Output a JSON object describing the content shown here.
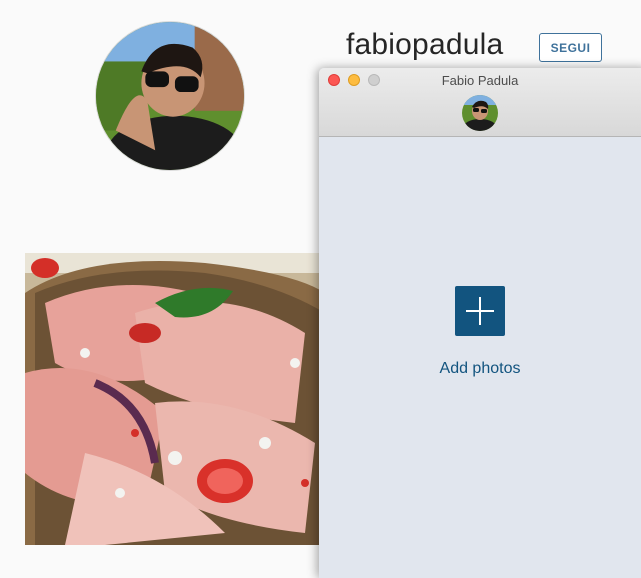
{
  "profile": {
    "username": "fabiopadula",
    "follow_label": "SEGUI",
    "avatar_icon": "profile-photo",
    "post_image": "pizza-prosciutto-photo"
  },
  "window": {
    "title": "Fabio Padula",
    "controls": [
      "close",
      "minimize",
      "zoom"
    ],
    "add_icon": "plus-icon",
    "add_label": "Add photos"
  },
  "colors": {
    "accent": "#12547f",
    "follow": "#3f729b",
    "window_bg": "#e1e6ee",
    "page_bg": "#fafafa"
  }
}
